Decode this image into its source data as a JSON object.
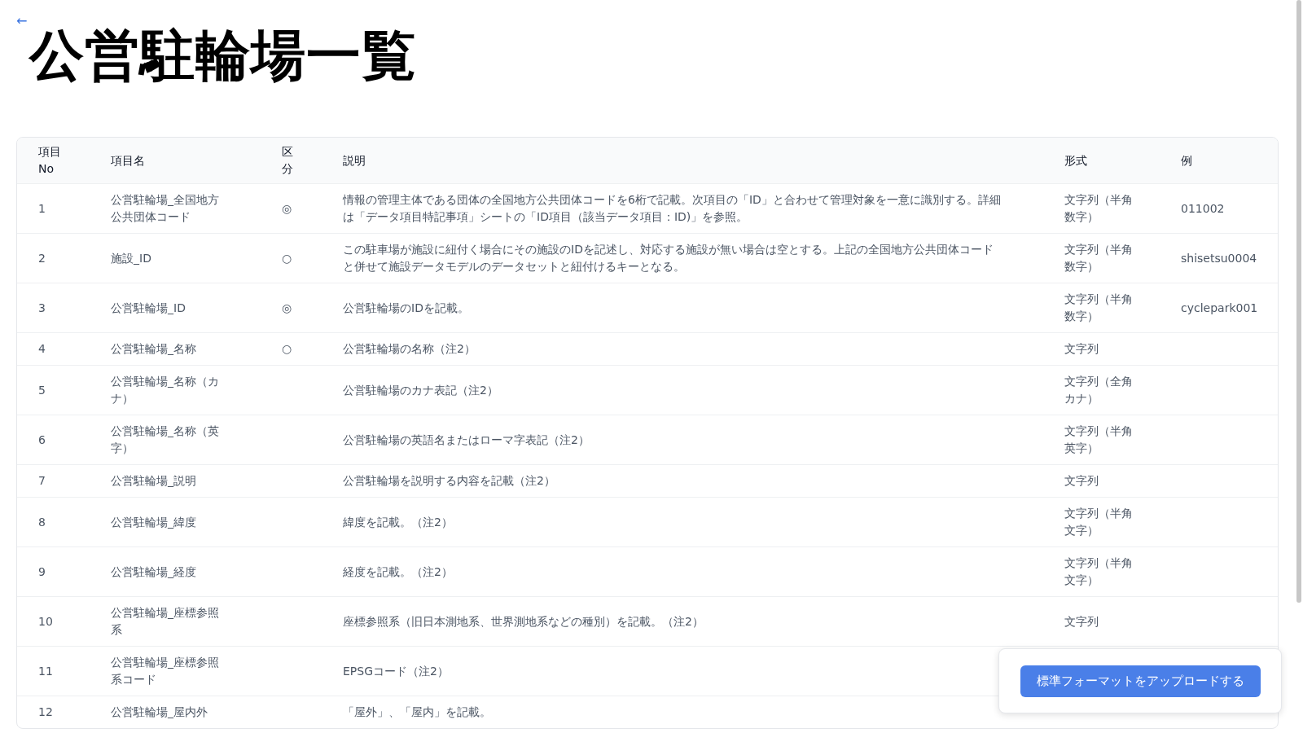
{
  "back_link": {
    "label": "←"
  },
  "title": "公営駐輪場一覧",
  "table": {
    "columns": [
      "項目No",
      "項目名",
      "区分",
      "説明",
      "形式",
      "例"
    ],
    "rows": [
      {
        "no": "1",
        "name": "公営駐輪場_全国地方公共団体コード",
        "kubun": "◎",
        "description": "情報の管理主体である団体の全国地方公共団体コードを6桁で記載。次項目の「ID」と合わせて管理対象を一意に識別する。詳細は「データ項目特記事項」シートの「ID項目（該当データ項目：ID)」を参照。",
        "format": "文字列（半角数字）",
        "example": "011002"
      },
      {
        "no": "2",
        "name": "施設_ID",
        "kubun": "○",
        "description": "この駐車場が施設に紐付く場合にその施設のIDを記述し、対応する施設が無い場合は空とする。上記の全国地方公共団体コードと併せて施設データモデルのデータセットと紐付けるキーとなる。",
        "format": "文字列（半角数字）",
        "example": "shisetsu0004"
      },
      {
        "no": "3",
        "name": "公営駐輪場_ID",
        "kubun": "◎",
        "description": "公営駐輪場のIDを記載。",
        "format": "文字列（半角数字）",
        "example": "cyclepark001"
      },
      {
        "no": "4",
        "name": "公営駐輪場_名称",
        "kubun": "○",
        "description": "公営駐輪場の名称（注2）",
        "format": "文字列"
      },
      {
        "no": "5",
        "name": "公営駐輪場_名称（カナ）",
        "description": "公営駐輪場のカナ表記（注2）",
        "format": "文字列（全角カナ）"
      },
      {
        "no": "6",
        "name": "公営駐輪場_名称（英字）",
        "description": "公営駐輪場の英語名またはローマ字表記（注2）",
        "format": "文字列（半角英字）"
      },
      {
        "no": "7",
        "name": "公営駐輪場_説明",
        "description": "公営駐輪場を説明する内容を記載（注2）",
        "format": "文字列"
      },
      {
        "no": "8",
        "name": "公営駐輪場_緯度",
        "description": "緯度を記載。（注2）",
        "format": "文字列（半角文字）"
      },
      {
        "no": "9",
        "name": "公営駐輪場_経度",
        "description": "経度を記載。（注2）",
        "format": "文字列（半角文字）"
      },
      {
        "no": "10",
        "name": "公営駐輪場_座標参照系",
        "description": "座標参照系（旧日本測地系、世界測地系などの種別）を記載。（注2）",
        "format": "文字列"
      },
      {
        "no": "11",
        "name": "公営駐輪場_座標参照系コード",
        "description": "EPSGコード（注2）"
      },
      {
        "no": "12",
        "name": "公営駐輪場_屋内外",
        "description": "「屋外」、「屋内」を記載。"
      }
    ]
  },
  "upload_button": {
    "label": "標準フォーマットをアップロードする"
  }
}
